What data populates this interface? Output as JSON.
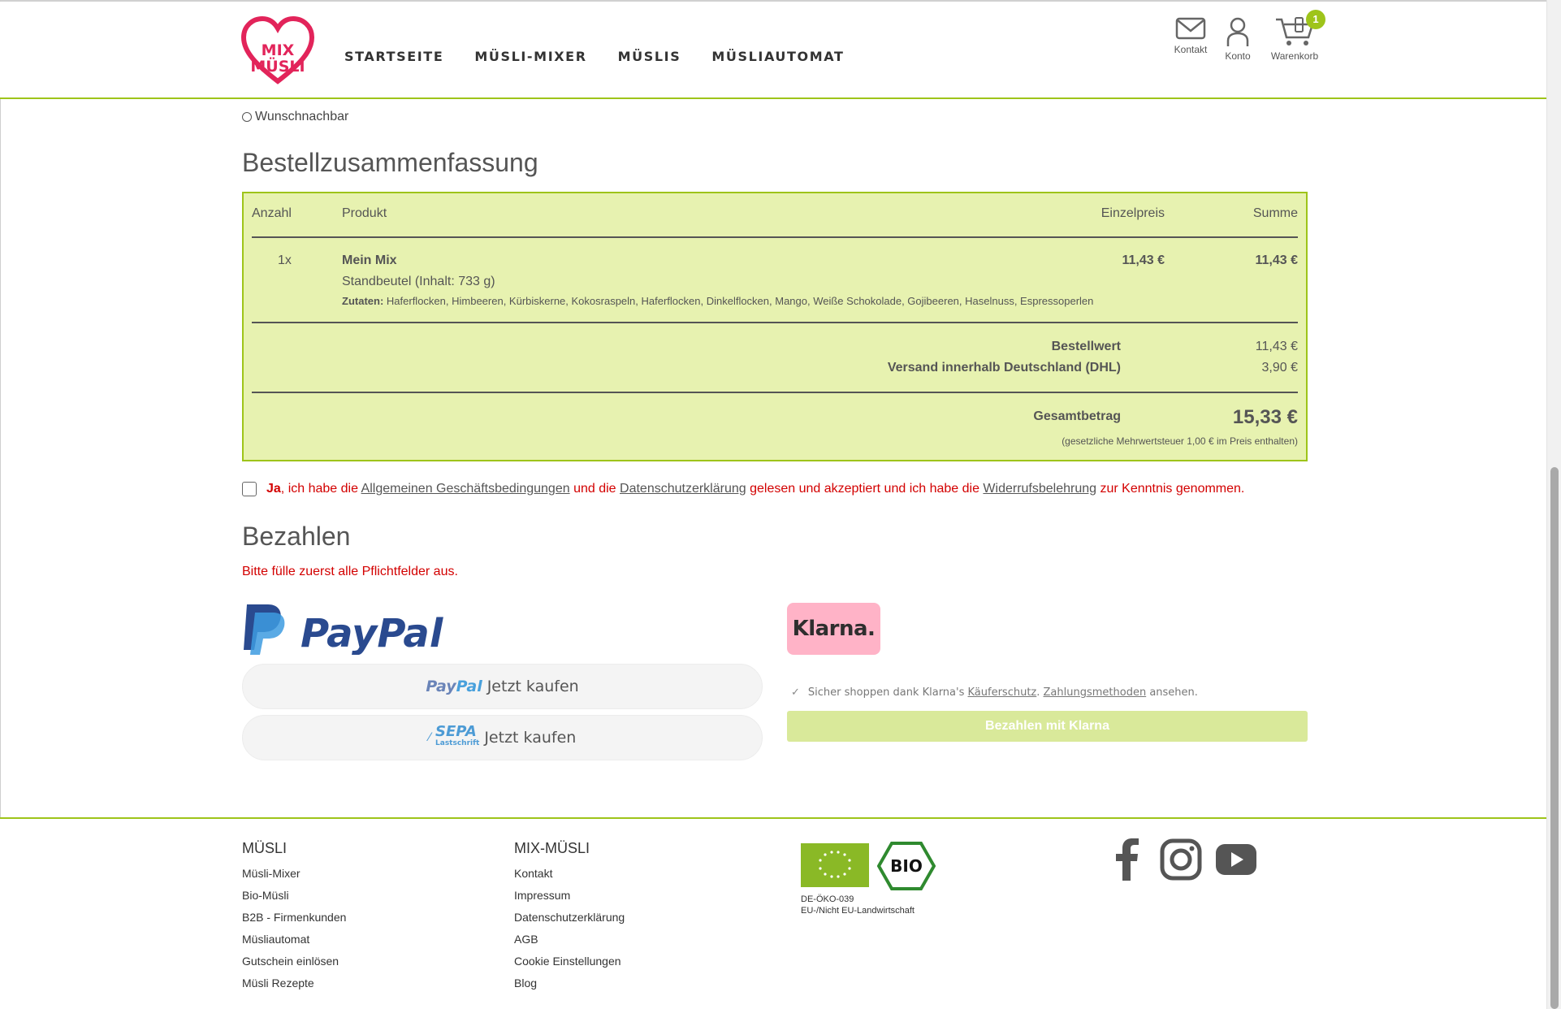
{
  "header": {
    "logo_text_top": "MIX",
    "logo_text_bottom": "MÜSLI",
    "nav": [
      "STARTSEITE",
      "MÜSLI-MIXER",
      "MÜSLIS",
      "MÜSLIAUTOMAT"
    ],
    "icons": [
      {
        "icon": "mail-icon",
        "label": "Kontakt"
      },
      {
        "icon": "user-icon",
        "label": "Konto"
      },
      {
        "icon": "cart-icon",
        "label": "Warenkorb"
      }
    ],
    "cart_count": "1",
    "accent_color": "#9ec41a"
  },
  "delivery_option": "Wunschnachbar",
  "summary": {
    "title": "Bestellzusammenfassung",
    "columns": {
      "qty": "Anzahl",
      "product": "Produkt",
      "unit_price": "Einzelpreis",
      "total": "Summe"
    },
    "item": {
      "qty": "1x",
      "name": "Mein Mix",
      "variant": "Standbeutel (Inhalt: 733 g)",
      "ingredients_label": "Zutaten:",
      "ingredients": "Haferflocken, Himbeeren, Kürbiskerne, Kokosraspeln, Haferflocken, Dinkelflocken, Mango, Weiße Schokolade, Gojibeeren, Haselnuss, Espressoperlen",
      "unit_price": "11,43 €",
      "total": "11,43 €"
    },
    "order_value_label": "Bestellwert",
    "order_value": "11,43 €",
    "shipping_label": "Versand innerhalb Deutschland (DHL)",
    "shipping": "3,90 €",
    "grand_total_label": "Gesamtbetrag",
    "grand_total": "15,33 €",
    "vat_note": "(gesetzliche Mehrwertsteuer 1,00 € im Preis enthalten)"
  },
  "agreement": {
    "ja": "Ja",
    "t1": ", ich habe die ",
    "agb": "Allgemeinen Geschäftsbedingungen",
    "t2": " und die ",
    "privacy": "Datenschutzerklärung",
    "t3": " gelesen und akzeptiert und ich habe die ",
    "withdrawal": "Widerrufsbelehrung",
    "t4": " zur Kenntnis genommen."
  },
  "payment": {
    "title": "Bezahlen",
    "error": "Bitte fülle zuerst alle Pflichtfelder aus.",
    "paypal_logo": "PayPal",
    "paypal_btn_brand_a": "Pay",
    "paypal_btn_brand_b": "Pal",
    "buy_now": "Jetzt kaufen",
    "sepa_brand": "SEPA",
    "sepa_sub": "Lastschrift",
    "klarna_logo": "Klarna.",
    "klarna_note_a": "Sicher shoppen dank Klarna's ",
    "klarna_buyer_protection": "Käuferschutz",
    "klarna_sep": ". ",
    "klarna_methods": "Zahlungsmethoden",
    "klarna_note_b": " ansehen.",
    "klarna_button": "Bezahlen mit Klarna"
  },
  "footer": {
    "col1_title": "MÜSLI",
    "col1_links": [
      "Müsli-Mixer",
      "Bio-Müsli",
      "B2B - Firmenkunden",
      "Müsliautomat",
      "Gutschein einlösen",
      "Müsli Rezepte"
    ],
    "col2_title": "MIX-MÜSLI",
    "col2_links": [
      "Kontakt",
      "Impressum",
      "Datenschutzerklärung",
      "AGB",
      "Cookie Einstellungen",
      "Blog"
    ],
    "bio_label": "BIO",
    "cert_code": "DE-ÖKO-039",
    "cert_origin": "EU-/Nicht EU-Landwirtschaft",
    "social": [
      "facebook-icon",
      "instagram-icon",
      "youtube-icon"
    ]
  }
}
